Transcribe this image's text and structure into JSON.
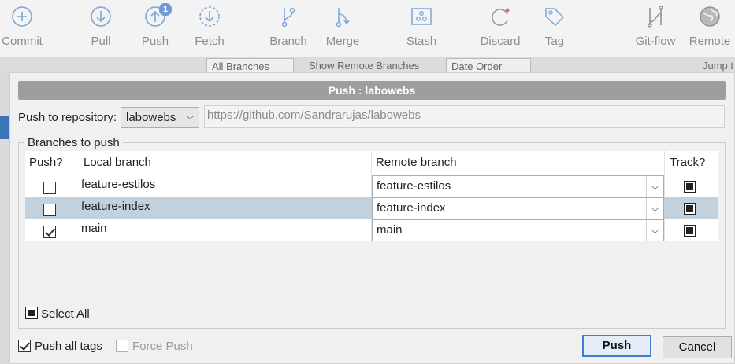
{
  "toolbar": {
    "items": [
      {
        "label": "Commit",
        "icon": "commit-icon"
      },
      {
        "label": "Pull",
        "icon": "pull-icon"
      },
      {
        "label": "Push",
        "icon": "push-icon",
        "badge": "1"
      },
      {
        "label": "Fetch",
        "icon": "fetch-icon"
      },
      {
        "label": "Branch",
        "icon": "branch-icon"
      },
      {
        "label": "Merge",
        "icon": "merge-icon"
      },
      {
        "label": "Stash",
        "icon": "stash-icon"
      },
      {
        "label": "Discard",
        "icon": "discard-icon"
      },
      {
        "label": "Tag",
        "icon": "tag-icon"
      },
      {
        "label": "Git-flow",
        "icon": "git-flow-icon"
      },
      {
        "label": "Remote",
        "icon": "remote-icon"
      }
    ]
  },
  "background": {
    "branches_filter": "All Branches",
    "show_remote": "Show Remote Branches",
    "order": "Date Order",
    "jump": "Jump t"
  },
  "dialog": {
    "title": "Push :  labowebs",
    "repo_label": "Push to repository:",
    "repo_value": "labowebs",
    "repo_url": "https://github.com/Sandrarujas/labowebs",
    "group_title": "Branches to push",
    "columns": {
      "push": "Push?",
      "local": "Local branch",
      "remote": "Remote branch",
      "track": "Track?"
    },
    "rows": [
      {
        "push": false,
        "local": "feature-estilos",
        "remote": "feature-estilos",
        "track": true,
        "selected": false
      },
      {
        "push": false,
        "local": "feature-index",
        "remote": "feature-index",
        "track": true,
        "selected": true
      },
      {
        "push": true,
        "local": "main",
        "remote": "main",
        "track": true,
        "selected": false
      }
    ],
    "select_all": "Select All",
    "push_all_tags": "Push all tags",
    "force_push": "Force Push",
    "push_button": "Push",
    "cancel_button": "Cancel"
  },
  "colors": {
    "accent": "#3b7fd0",
    "selected_row": "#c2d1de",
    "title_bar": "#9e9e9e",
    "badge": "#6e9bd0"
  }
}
